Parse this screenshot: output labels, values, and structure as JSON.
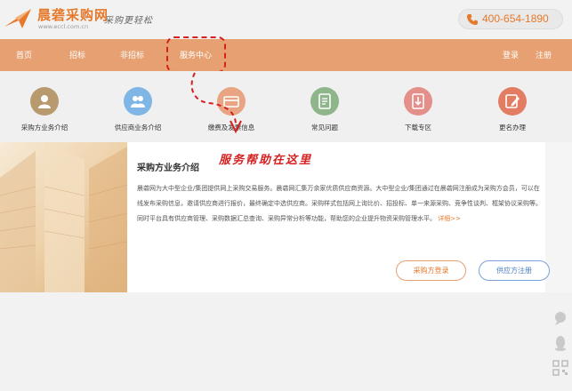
{
  "header": {
    "logo_name": "晨砻采购网",
    "logo_url": "www.eccl.com.cn",
    "slogan": "采购更轻松",
    "phone": "400-654-1890",
    "brand_color": "#e6792b"
  },
  "nav": {
    "bg_color": "#e6a071",
    "items": [
      "首页",
      "招标",
      "非招标",
      "服务中心"
    ],
    "login": "登录",
    "register": "注册"
  },
  "services": [
    {
      "label": "采购方业务介绍",
      "icon": "buyer-person-icon",
      "color": "#b89a6e"
    },
    {
      "label": "供应商业务介绍",
      "icon": "supplier-people-icon",
      "color": "#7fb6e6"
    },
    {
      "label": "缴费及发票信息",
      "icon": "invoice-card-icon",
      "color": "#e8a483"
    },
    {
      "label": "常见问题",
      "icon": "faq-document-icon",
      "color": "#8fb58a"
    },
    {
      "label": "下载专区",
      "icon": "download-document-icon",
      "color": "#e58f8a"
    },
    {
      "label": "更名办理",
      "icon": "rename-edit-icon",
      "color": "#e27d63"
    }
  ],
  "annotation": {
    "text": "服务帮助在这里",
    "color": "#d42020"
  },
  "intro": {
    "title": "采购方业务介绍",
    "body": "晨砻网为大中型企业/集团提供网上采购交易服务。晨砻网汇集万余家优质供应商资源。大中型企业/集团通过在晨砻网注册成为采购方会员，可以在线发布采购信息，邀请供应商进行报价，最终确定中选供应商。采购样式包括网上询比价、招投标、单一来源采购、竞争性谈判、框架协议采购等。同时平台具有供应商管理、采购数据汇总查询、采购异常分析等功能，帮助您的企业提升物资采购管理水平。",
    "more": "详细>>",
    "buyer_login": "采购方登录",
    "supplier_register": "供应方注册"
  }
}
